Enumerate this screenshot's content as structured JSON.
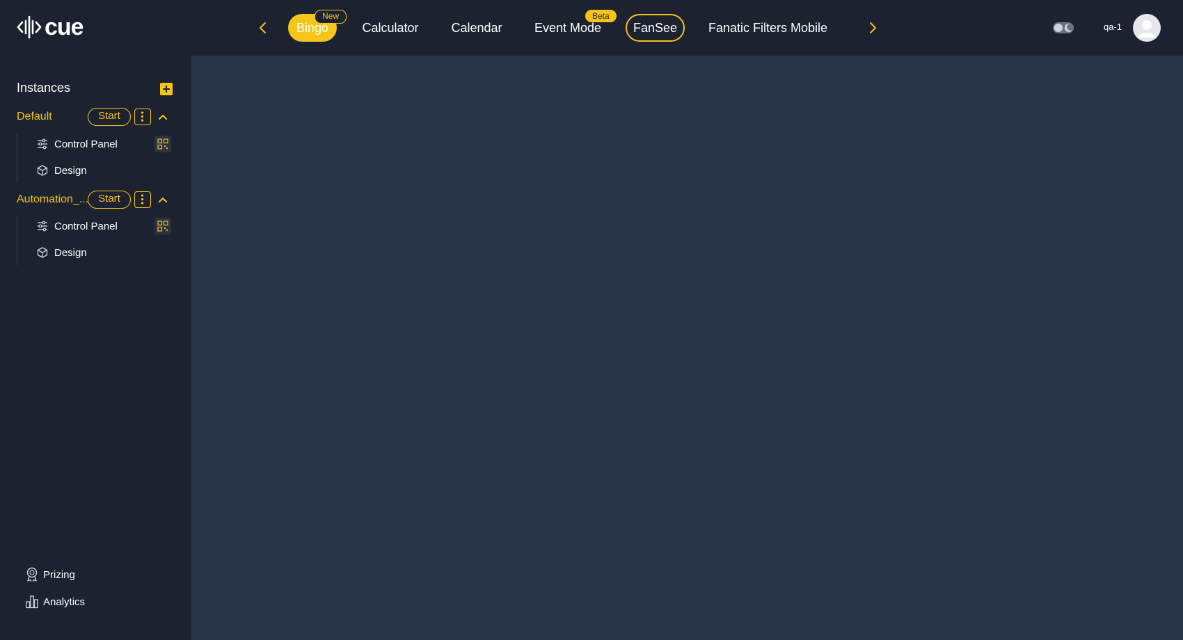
{
  "colors": {
    "accent": "#f5c518",
    "background": "#1c2230",
    "main_panel": "#2a3549"
  },
  "header": {
    "logo_text": "cue",
    "tabs": [
      {
        "label": "Bingo",
        "badge": "New",
        "state": "selected"
      },
      {
        "label": "Calculator"
      },
      {
        "label": "Calendar"
      },
      {
        "label": "Event Mode",
        "badge": "Beta"
      },
      {
        "label": "FanSee",
        "state": "outlined"
      },
      {
        "label": "Fanatic Filters Mobile"
      }
    ],
    "prev_icon": "chevron-left-icon",
    "next_icon": "chevron-right-icon",
    "theme_toggle_icon": "moon-toggle-icon",
    "username": "qa-1",
    "avatar_icon": "user-avatar-icon"
  },
  "sidebar": {
    "title": "Instances",
    "add_icon": "plus-icon",
    "instances": [
      {
        "name": "Default",
        "start_label": "Start",
        "items": [
          {
            "label": "Control Panel",
            "icon": "sliders-icon",
            "has_qr": true
          },
          {
            "label": "Design",
            "icon": "cube-icon"
          }
        ]
      },
      {
        "name": "Automation_...",
        "start_label": "Start",
        "items": [
          {
            "label": "Control Panel",
            "icon": "sliders-icon",
            "has_qr": true
          },
          {
            "label": "Design",
            "icon": "cube-icon"
          }
        ]
      }
    ],
    "bottom": [
      {
        "label": "Prizing",
        "icon": "award-icon"
      },
      {
        "label": "Analytics",
        "icon": "bar-chart-icon"
      }
    ]
  }
}
